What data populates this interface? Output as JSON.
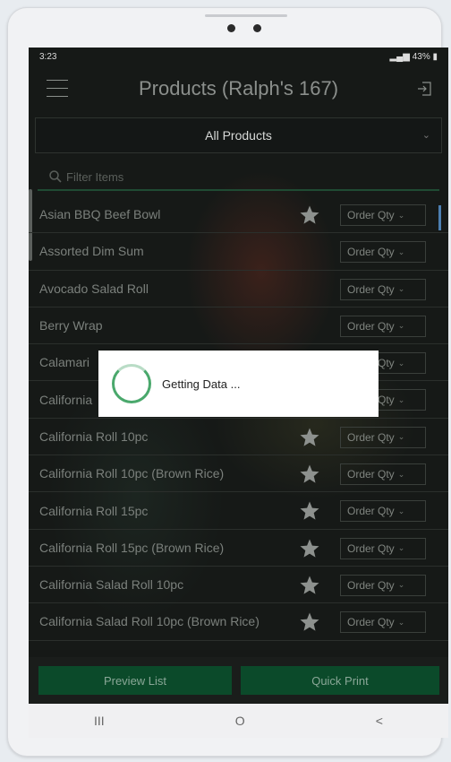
{
  "status_bar": {
    "time": "3:23",
    "battery": "43%"
  },
  "header": {
    "title": "Products (Ralph's 167)"
  },
  "category_select": {
    "value": "All Products"
  },
  "filter": {
    "placeholder": "Filter Items"
  },
  "products": [
    {
      "name": "Asian BBQ Beef Bowl",
      "starred": true,
      "qty_label": "Order Qty"
    },
    {
      "name": "Assorted Dim Sum",
      "starred": false,
      "qty_label": "Order Qty"
    },
    {
      "name": "Avocado Salad Roll",
      "starred": false,
      "qty_label": "Order Qty"
    },
    {
      "name": "Berry Wrap",
      "starred": false,
      "qty_label": "Order Qty"
    },
    {
      "name": "Calamari",
      "starred": false,
      "qty_label": "Order Qty"
    },
    {
      "name": "California",
      "starred": false,
      "qty_label": "Order Qty"
    },
    {
      "name": "California Roll 10pc",
      "starred": true,
      "qty_label": "Order Qty"
    },
    {
      "name": "California Roll 10pc (Brown Rice)",
      "starred": true,
      "qty_label": "Order Qty"
    },
    {
      "name": "California Roll 15pc",
      "starred": true,
      "qty_label": "Order Qty"
    },
    {
      "name": "California Roll 15pc (Brown Rice)",
      "starred": true,
      "qty_label": "Order Qty"
    },
    {
      "name": "California Salad Roll 10pc",
      "starred": true,
      "qty_label": "Order Qty"
    },
    {
      "name": "California Salad Roll 10pc (Brown Rice)",
      "starred": true,
      "qty_label": "Order Qty"
    }
  ],
  "footer": {
    "preview_label": "Preview List",
    "print_label": "Quick Print"
  },
  "loading_dialog": {
    "message": "Getting Data ..."
  },
  "nav": {
    "recent": "III",
    "home": "O",
    "back": "<"
  },
  "colors": {
    "accent": "#0b4a2a",
    "spinner": "#4aa86c"
  }
}
